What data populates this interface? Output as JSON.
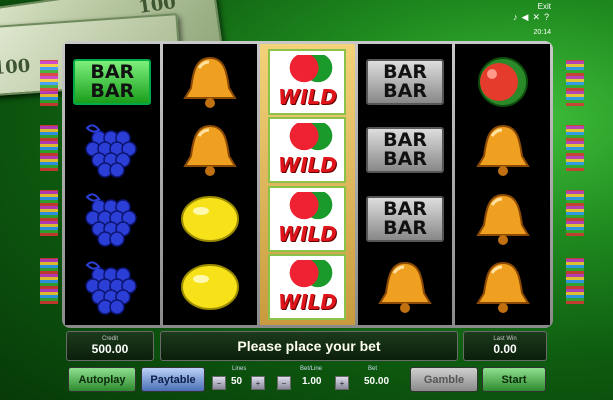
{
  "money": {
    "note_text": "100"
  },
  "top": {
    "exit_label": "Exit",
    "time": "20:14"
  },
  "reels": [
    [
      "bar-green",
      "grapes",
      "grapes",
      "grapes"
    ],
    [
      "bell",
      "bell",
      "lemon",
      "lemon"
    ],
    [
      "wild",
      "wild",
      "wild",
      "wild"
    ],
    [
      "bar-grey",
      "bar-grey",
      "bar-grey",
      "bell"
    ],
    [
      "melon",
      "bell",
      "bell",
      "bell"
    ]
  ],
  "symbols": {
    "bar_text": "BAR",
    "wild_text": "WILD"
  },
  "credit": {
    "label": "Credit",
    "value": "500.00"
  },
  "message": "Please place your bet",
  "last_win": {
    "label": "Last Win",
    "value": "0.00"
  },
  "buttons": {
    "autoplay": "Autoplay",
    "paytable": "Paytable",
    "gamble": "Gamble",
    "start": "Start"
  },
  "lines": {
    "label": "Lines",
    "value": "50"
  },
  "bet_line": {
    "label": "Bet/Line",
    "value": "1.00"
  },
  "bet": {
    "label": "Bet",
    "value": "50.00"
  },
  "colors": {
    "accent_green": "#2e8a2e",
    "accent_blue": "#4a6fb5",
    "wild_red": "#e0151b"
  }
}
